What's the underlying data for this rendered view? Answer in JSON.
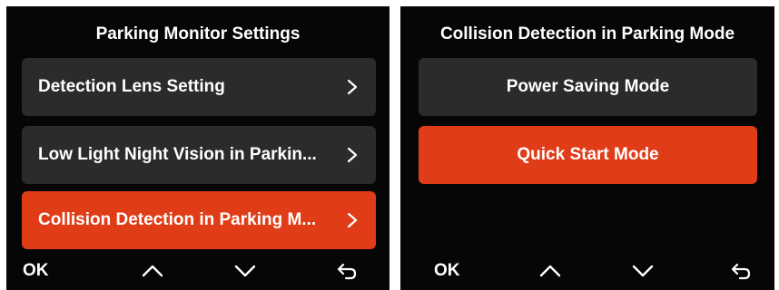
{
  "left": {
    "title": "Parking Monitor Settings",
    "items": [
      {
        "label": "Detection Lens Setting",
        "selected": false
      },
      {
        "label": "Low Light Night Vision in Parkin...",
        "selected": false
      },
      {
        "label": "Collision Detection in Parking M...",
        "selected": true
      }
    ],
    "bottom": {
      "ok_label": "OK",
      "icons": [
        "chevron-up-icon",
        "chevron-down-icon",
        "back-arrow-icon"
      ]
    }
  },
  "right": {
    "title": "Collision Detection in Parking Mode",
    "options": [
      {
        "label": "Power Saving Mode",
        "selected": false
      },
      {
        "label": "Quick Start Mode",
        "selected": true
      }
    ],
    "bottom": {
      "ok_label": "OK",
      "icons": [
        "chevron-up-icon",
        "chevron-down-icon",
        "back-arrow-icon"
      ]
    }
  },
  "colors": {
    "accent": "#e03c17",
    "item_bg": "#2a2b2d",
    "screen_bg": "#060606"
  }
}
